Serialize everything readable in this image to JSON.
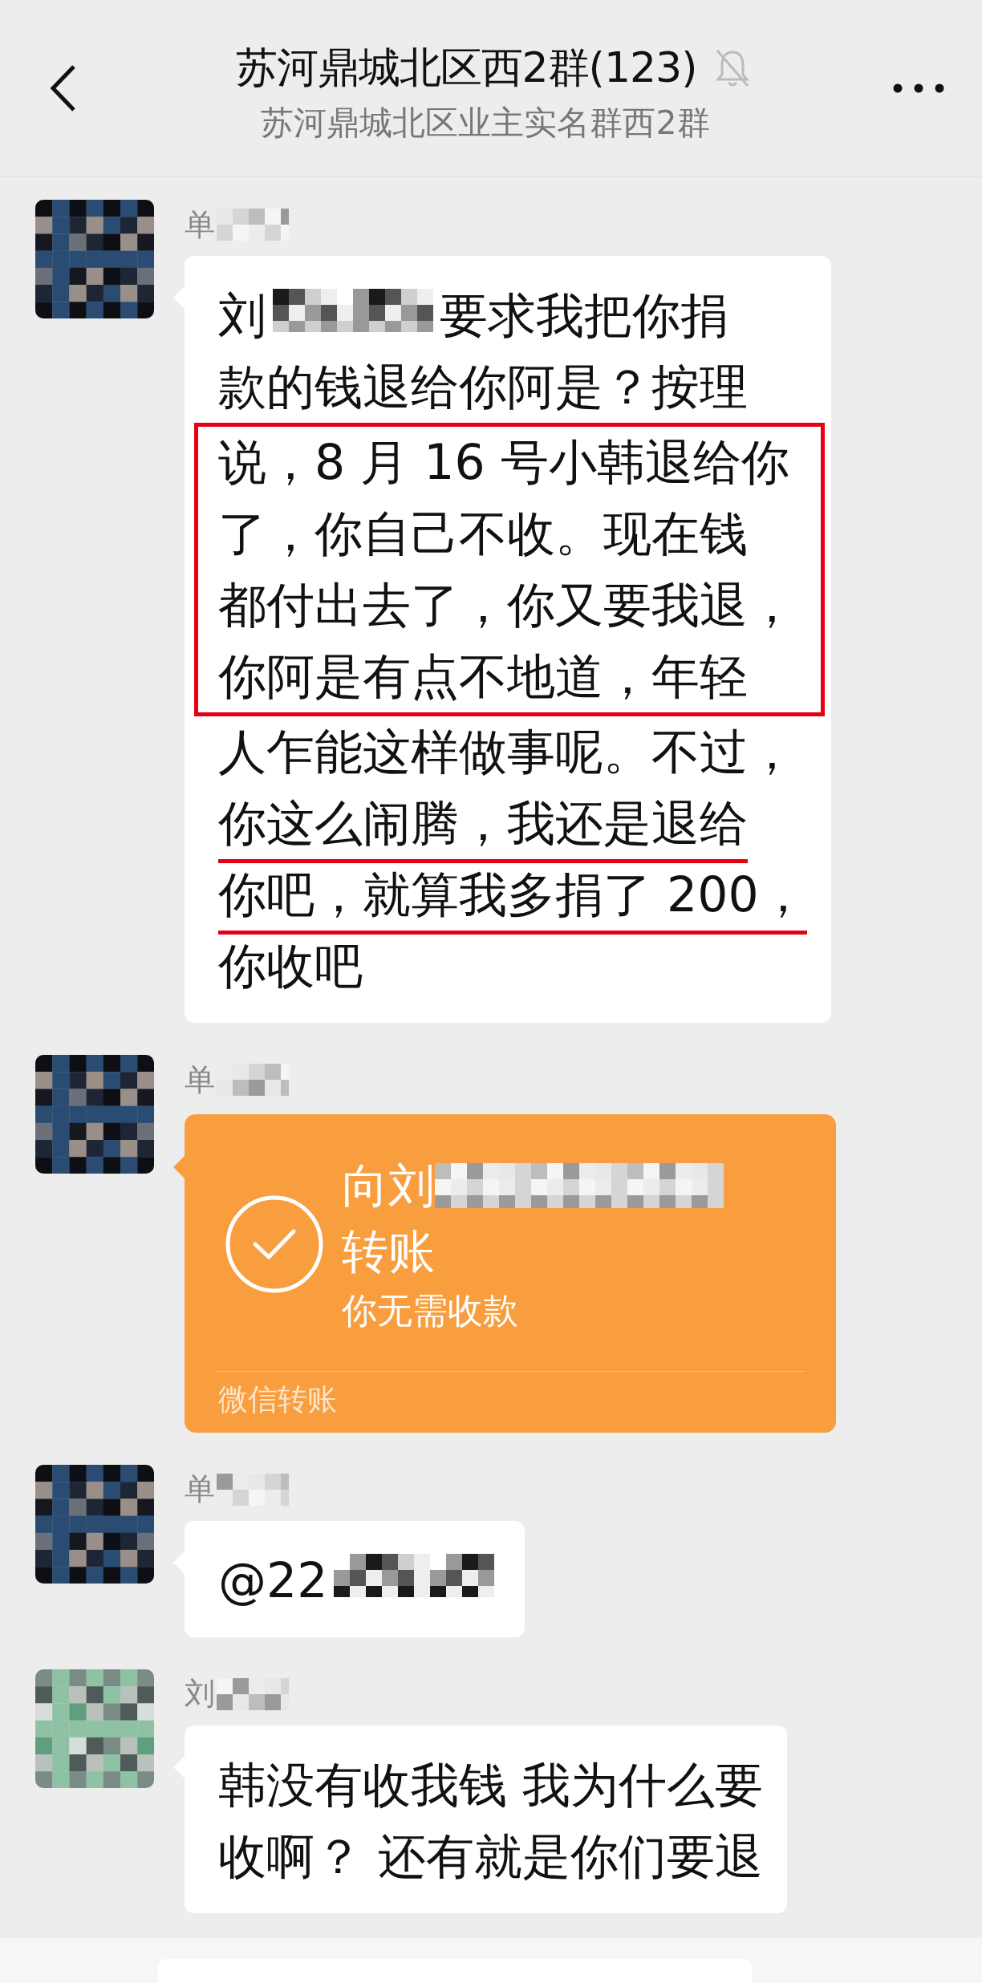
{
  "header": {
    "title": "苏河鼎城北区西2群(123)",
    "subtitle": "苏河鼎城北区业主实名群西2群",
    "muted": true
  },
  "messages": [
    {
      "kind": "text",
      "sender": "单",
      "sender_redacted": true,
      "segments": [
        {
          "kind": "plain",
          "lines": [
            {
              "text": "刘",
              "redacted": true,
              "after": "要求我把你捐"
            },
            {
              "text": "款的钱退给你阿是？按理",
              "redacted": false
            }
          ]
        },
        {
          "kind": "boxed",
          "lines": [
            {
              "text": "说，8 月 16 号小韩退给你",
              "redacted": false
            },
            {
              "text": "了，你自己不收。现在钱",
              "redacted": false
            },
            {
              "text": "都付出去了，你又要我退，",
              "redacted": false
            },
            {
              "text": "你阿是有点不地道，年轻",
              "redacted": false
            }
          ]
        },
        {
          "kind": "plain",
          "lines": [
            {
              "text": "人乍能这样做事呢。不过，",
              "redacted": false
            }
          ]
        },
        {
          "kind": "underlined",
          "lines": [
            {
              "text": "你这么闹腾，我还是退给",
              "redacted": false
            },
            {
              "text": "你吧，就算我多捐了 200，",
              "redacted": false
            }
          ]
        },
        {
          "kind": "plain",
          "lines": [
            {
              "text": "你收吧",
              "redacted": false
            }
          ]
        }
      ]
    },
    {
      "kind": "transfer",
      "sender": "单",
      "sender_redacted": true,
      "to": "向刘",
      "to_redacted": true,
      "title": "转账",
      "status": "你无需收款",
      "footer": "微信转账"
    },
    {
      "kind": "text",
      "sender": "单",
      "sender_redacted": true,
      "segments": [
        {
          "kind": "plain",
          "lines": [
            {
              "text": "@22",
              "redacted": true
            }
          ]
        }
      ]
    },
    {
      "kind": "text",
      "sender": "刘",
      "sender_redacted": true,
      "segments": [
        {
          "kind": "plain",
          "lines": [
            {
              "text": "韩没有收我钱  我为什么要",
              "redacted": false
            },
            {
              "text": "收啊？  还有就是你们要退",
              "redacted": false
            }
          ]
        }
      ]
    }
  ]
}
